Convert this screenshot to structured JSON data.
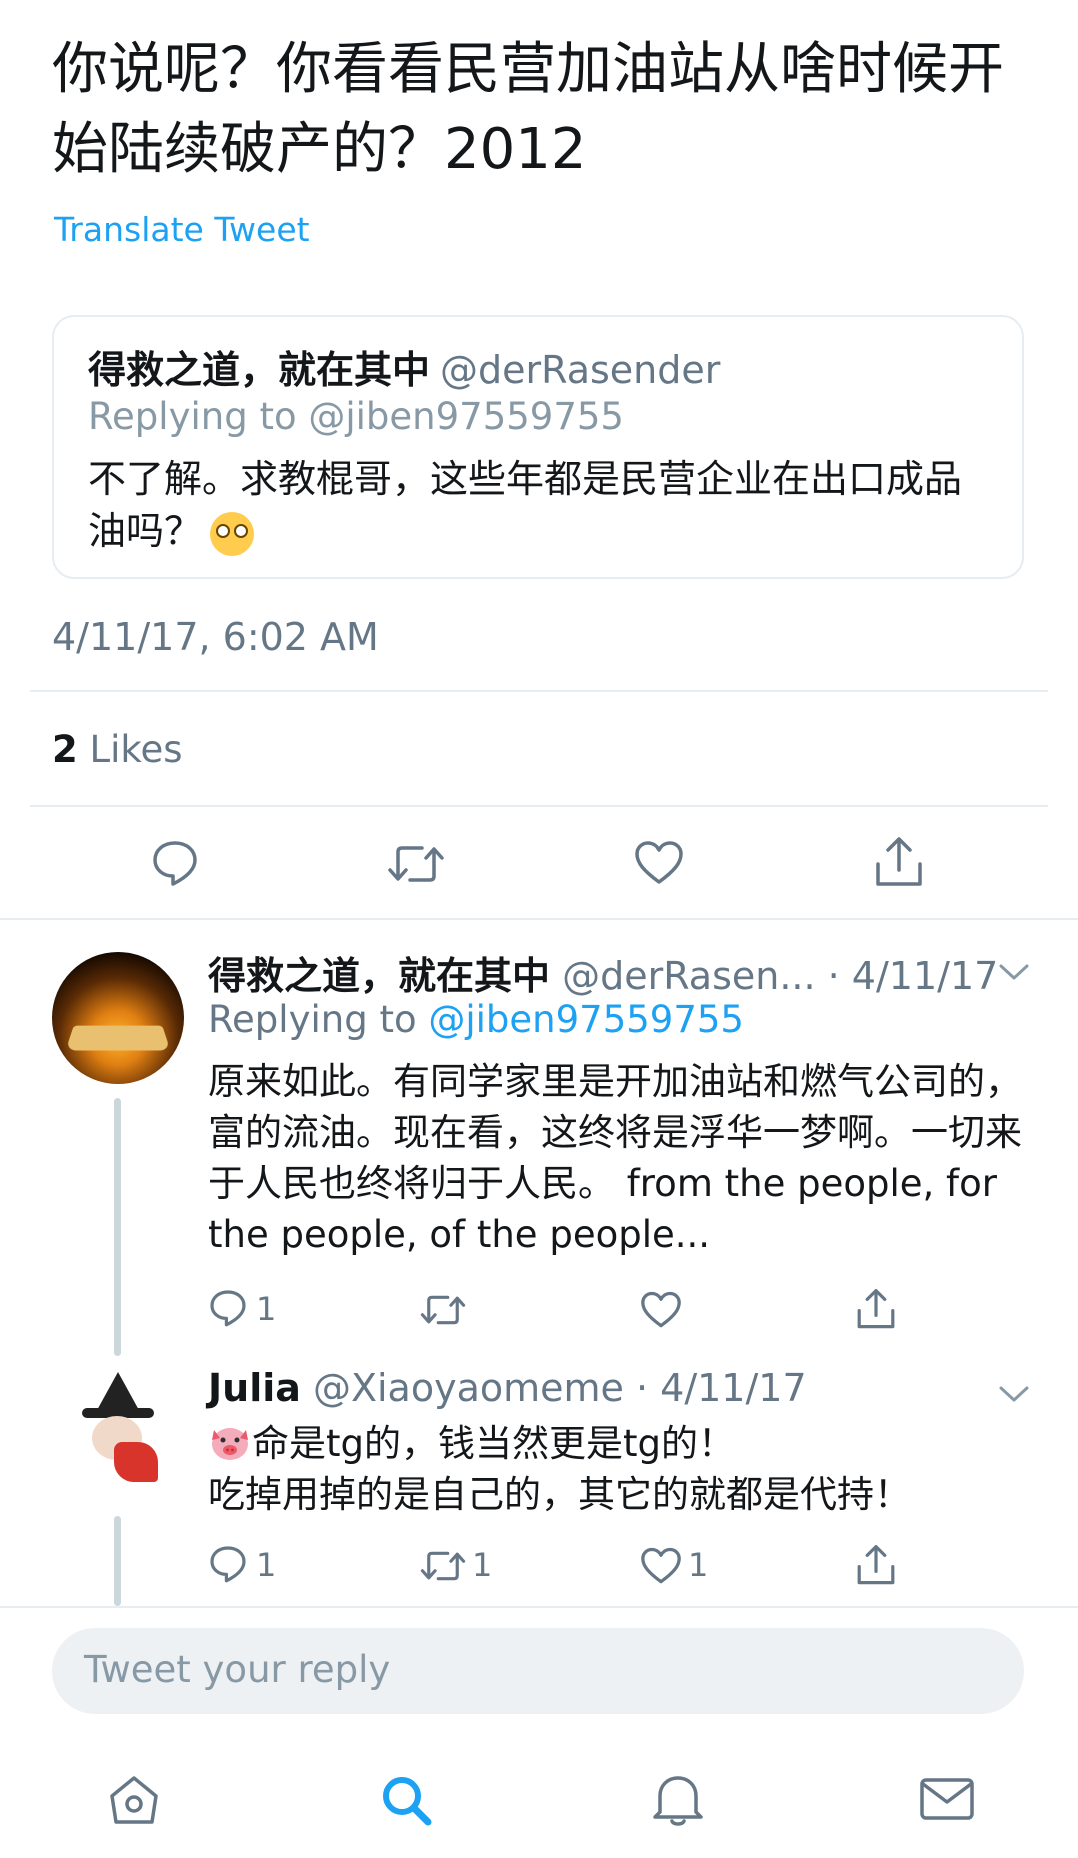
{
  "tweet": {
    "text": "你说呢？你看看民营加油站从啥时候开始陆续破产的？2012",
    "translate_label": "Translate Tweet",
    "timestamp": "4/11/17, 6:02 AM",
    "likes_count": "2",
    "likes_label": " Likes"
  },
  "quoted": {
    "name": "得救之道，就在其中",
    "handle": "@derRasender",
    "replying": "Replying to @jiben97559755",
    "text": "不了解。求教棍哥，这些年都是民营企业在出口成品油吗？"
  },
  "replies": [
    {
      "name": "得救之道，就在其中",
      "meta": " @derRasen... · 4/11/17",
      "replying_prefix": "Replying to ",
      "replying_handle": "@jiben97559755",
      "text": "原来如此。有同学家里是开加油站和燃气公司的，富的流油。现在看，这终将是浮华一梦啊。一切来于人民也终将归于人民。 from the people, for the people, of the people...",
      "reply_count": "1",
      "retweet_count": "",
      "like_count": ""
    },
    {
      "name": "Julia",
      "meta": " @Xiaoyaomeme · 4/11/17",
      "text_line1": "命是tg的，钱当然更是tg的！",
      "text_line2": "吃掉用掉的是自己的，其它的就都是代持！",
      "reply_count": "1",
      "retweet_count": "1",
      "like_count": "1"
    }
  ],
  "compose": {
    "placeholder": "Tweet your reply"
  },
  "colors": {
    "link": "#1da1f2",
    "secondary": "#657786",
    "divider": "#e6ecf0"
  }
}
